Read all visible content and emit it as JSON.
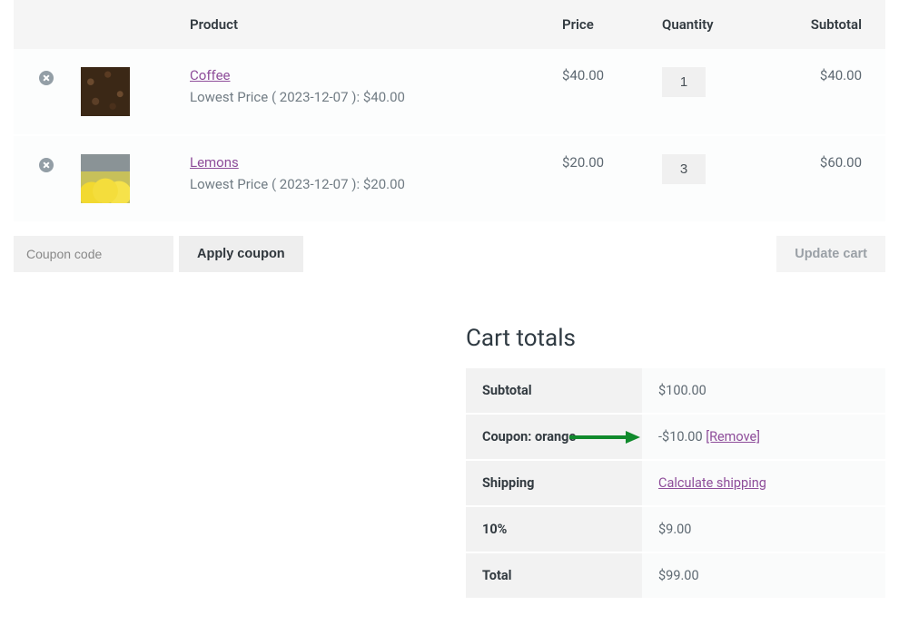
{
  "headers": {
    "product": "Product",
    "price": "Price",
    "quantity": "Quantity",
    "subtotal": "Subtotal"
  },
  "items": [
    {
      "name": "Coffee",
      "lowest_price_note": "Lowest Price ( 2023-12-07 ): $40.00",
      "price": "$40.00",
      "qty": "1",
      "subtotal": "$40.00",
      "thumb_class": "coffee"
    },
    {
      "name": "Lemons",
      "lowest_price_note": "Lowest Price ( 2023-12-07 ): $20.00",
      "price": "$20.00",
      "qty": "3",
      "subtotal": "$60.00",
      "thumb_class": "lemons"
    }
  ],
  "coupon": {
    "placeholder": "Coupon code",
    "apply_label": "Apply coupon"
  },
  "update_label": "Update cart",
  "totals": {
    "title": "Cart totals",
    "rows": {
      "subtotal_label": "Subtotal",
      "subtotal_value": "$100.00",
      "coupon_label": "Coupon: orange",
      "coupon_value": "-$10.00 ",
      "coupon_remove": "[Remove]",
      "shipping_label": "Shipping",
      "shipping_link": "Calculate shipping",
      "tax_label": "10%",
      "tax_value": "$9.00",
      "total_label": "Total",
      "total_value": "$99.00"
    }
  }
}
